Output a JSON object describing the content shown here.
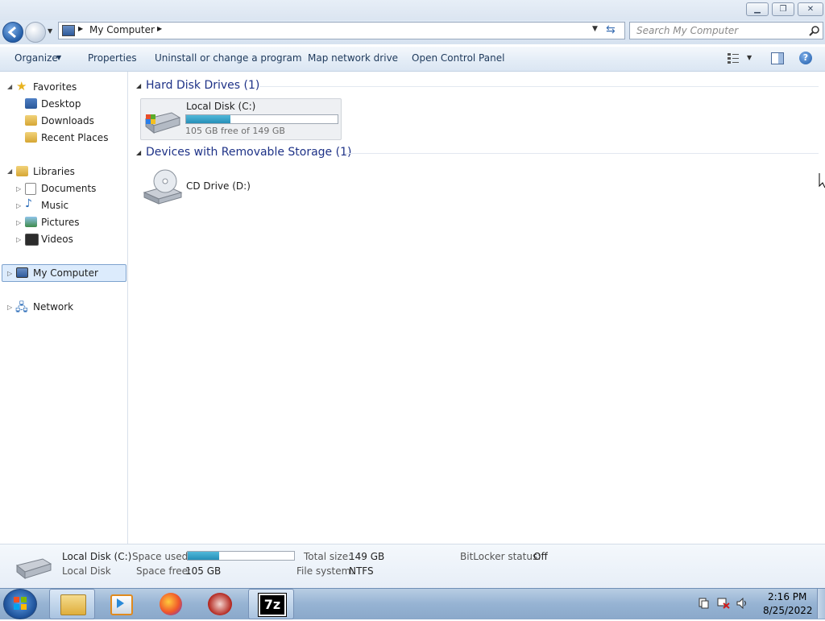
{
  "address": {
    "path_item": "My Computer",
    "search_placeholder": "Search My Computer"
  },
  "toolbar": {
    "organize": "Organize",
    "properties": "Properties",
    "uninstall": "Uninstall or change a program",
    "map_drive": "Map network drive",
    "control_panel": "Open Control Panel"
  },
  "nav": {
    "favorites": "Favorites",
    "desktop": "Desktop",
    "downloads": "Downloads",
    "recent": "Recent Places",
    "libraries": "Libraries",
    "documents": "Documents",
    "music": "Music",
    "pictures": "Pictures",
    "videos": "Videos",
    "my_computer": "My Computer",
    "network": "Network"
  },
  "groups": {
    "hdd": "Hard Disk Drives (1)",
    "removable": "Devices with Removable Storage (1)"
  },
  "drives": {
    "c_name": "Local Disk (C:)",
    "c_free": "105 GB free of 149 GB",
    "c_used_fraction": 0.295,
    "d_name": "CD Drive (D:)"
  },
  "details": {
    "name": "Local Disk (C:)",
    "type": "Local Disk",
    "space_used_label": "Space used:",
    "space_free_label": "Space free:",
    "space_free": "105 GB",
    "total_label": "Total size:",
    "total": "149 GB",
    "fs_label": "File system:",
    "fs": "NTFS",
    "bitlocker_label": "BitLocker status:",
    "bitlocker": "Off"
  },
  "taskbar": {
    "time": "2:16 PM",
    "date": "8/25/2022",
    "sevenzip": "7z"
  },
  "colors": {
    "accent": "#1e3287",
    "selection": "#dcebfc",
    "progress": "#268fb8"
  }
}
